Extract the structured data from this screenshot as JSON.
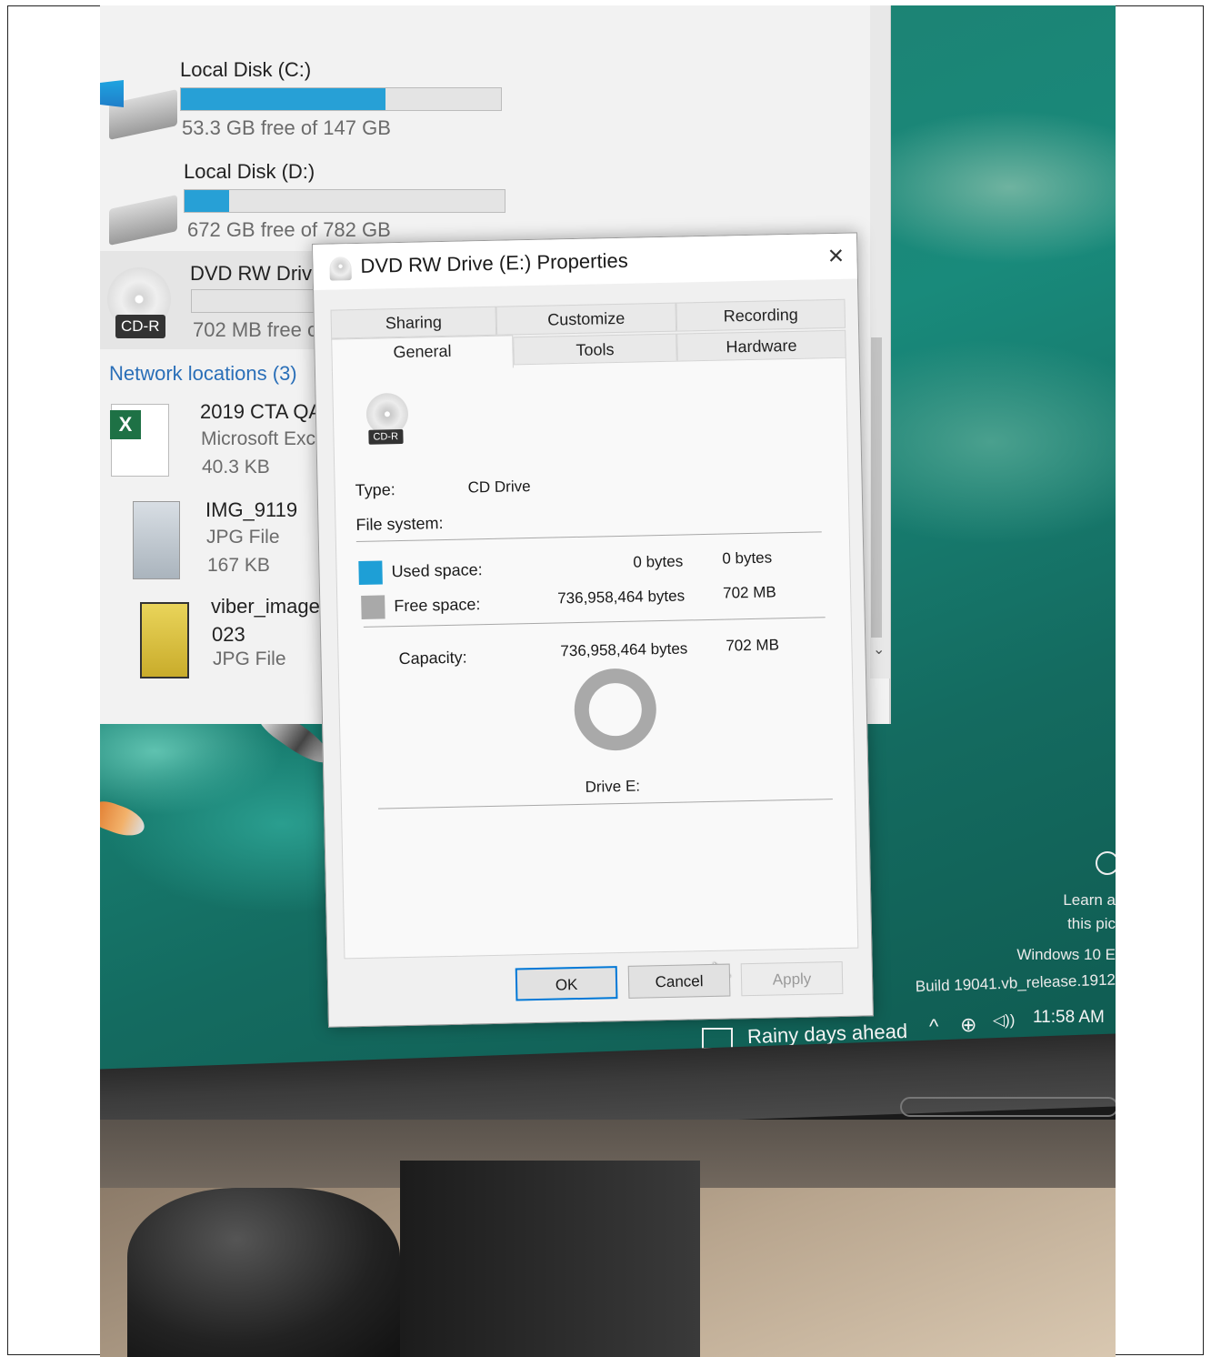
{
  "explorer": {
    "drives": [
      {
        "name": "Local Disk (C:)",
        "free_text": "53.3 GB free of 147 GB",
        "used_fraction": 0.64
      },
      {
        "name": "Local Disk (D:)",
        "free_text": "672 GB free of 782 GB",
        "used_fraction": 0.14
      },
      {
        "name": "DVD RW Driv",
        "free_text": "702 MB free o",
        "used_fraction": 0.0,
        "badge": "CD-R"
      }
    ],
    "section_title": "Network locations (3)",
    "files": [
      {
        "name": "2019 CTA QAI",
        "type": "Microsoft Exc",
        "size": "40.3 KB",
        "icon": "excel-icon"
      },
      {
        "name": "IMG_9119",
        "type": "JPG File",
        "size": "167 KB",
        "icon": "image-icon"
      },
      {
        "name": "viber_image_",
        "name2": "023",
        "type": "JPG File",
        "icon": "image-icon"
      }
    ]
  },
  "dialog": {
    "title": "DVD RW Drive (E:) Properties",
    "close": "×",
    "tabs_row1": [
      "Sharing",
      "Customize",
      "Recording"
    ],
    "tabs_row2": [
      "General",
      "Tools",
      "Hardware"
    ],
    "active_tab": "General",
    "badge": "CD-R",
    "type_label": "Type:",
    "type_value": "CD Drive",
    "fs_label": "File system:",
    "used_label": "Used space:",
    "used_bytes": "0 bytes",
    "used_size": "0 bytes",
    "free_label": "Free space:",
    "free_bytes": "736,958,464 bytes",
    "free_size": "702 MB",
    "capacity_label": "Capacity:",
    "capacity_bytes": "736,958,464 bytes",
    "capacity_size": "702 MB",
    "drive_label": "Drive E:",
    "used_color": "#1e9fd6",
    "free_color": "#a9a9a9",
    "buttons": {
      "ok": "OK",
      "cancel": "Cancel",
      "apply": "Apply"
    }
  },
  "desktop": {
    "learn_line1": "Learn a",
    "learn_line2": "this pic",
    "watermark1": "Windows 10 E",
    "watermark2": "Build 19041.vb_release.1912",
    "news": "Rainy days ahead",
    "time": "11:58 AM",
    "tray": {
      "chevron": "^",
      "globe": "⊕",
      "volume": "◁))"
    }
  }
}
